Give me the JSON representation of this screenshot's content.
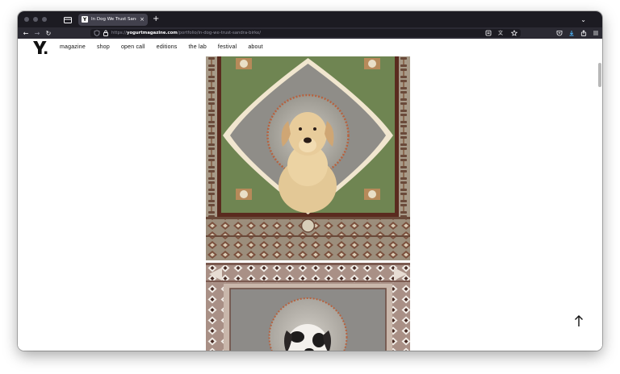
{
  "browser": {
    "tab": {
      "title": "In Dog We Trust Sandra Birke |",
      "favicon_letter": "Y"
    },
    "url": {
      "prefix": "https://",
      "domain": "yogurtmagazine.com",
      "path": "/portfolio/in-dog-we-trust-sandra-birke/"
    }
  },
  "site": {
    "logo": "Y.",
    "nav": [
      "magazine",
      "shop",
      "open call",
      "editions",
      "the lab",
      "festival",
      "about"
    ]
  },
  "page": {
    "back_to_top_icon": "arrow-up-icon"
  },
  "colors": {
    "browser_chrome": "#1c1b22",
    "toolbar": "#2b2a33",
    "artwork_green": "#6f8552",
    "artwork_brown": "#5a2b1f",
    "artwork_pink": "#a99086"
  }
}
